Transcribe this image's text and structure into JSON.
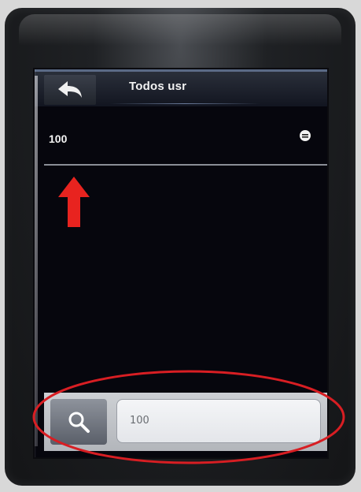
{
  "header": {
    "title": "Todos usr",
    "back_icon": "back-arrow-icon"
  },
  "user_list": {
    "items": [
      {
        "id": "100",
        "icon": "face-icon"
      }
    ]
  },
  "search": {
    "icon": "search-icon",
    "value": "100"
  },
  "annotations": {
    "arrow_color": "#e8231f",
    "ellipse_color": "#d81e23"
  },
  "colors": {
    "screen_bg": "#06060d",
    "title_accent": "#5b6a86"
  }
}
